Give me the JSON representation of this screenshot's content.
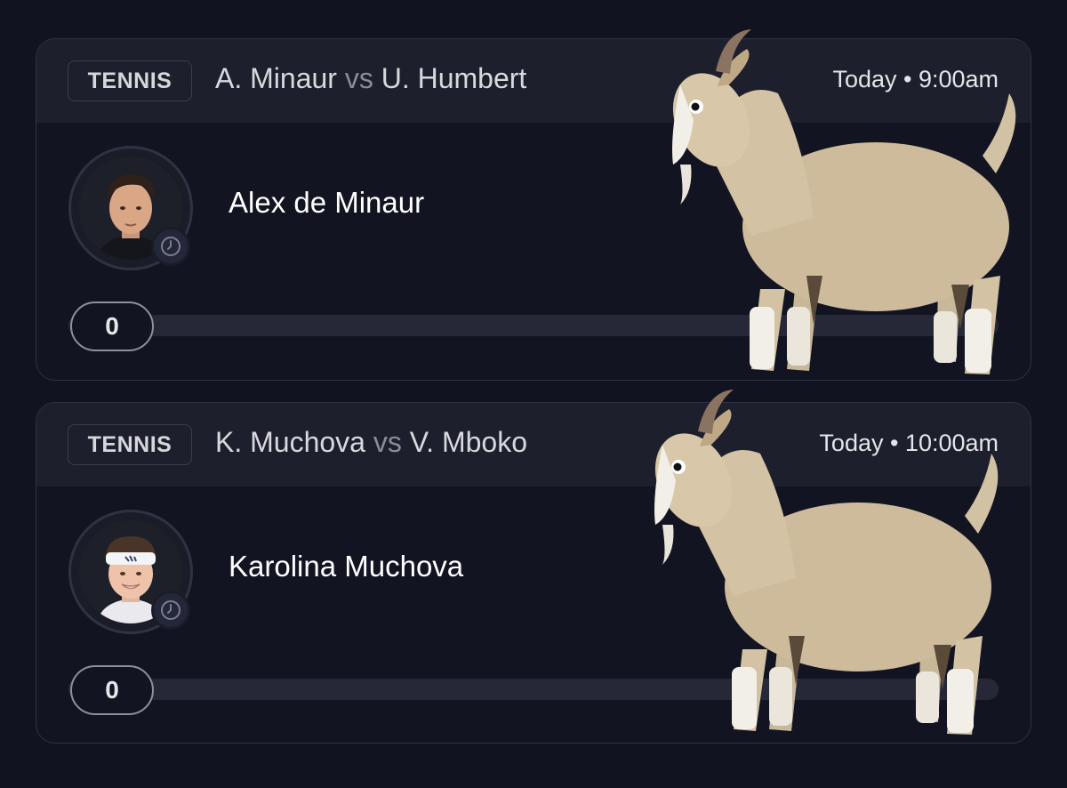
{
  "matches": [
    {
      "sport_label": "TENNIS",
      "player1": "A. Minaur",
      "vs": "vs",
      "player2": "U. Humbert",
      "time": "Today • 9:00am",
      "player_name": "Alex de Minaur",
      "score": "0",
      "slider_fraction": 0
    },
    {
      "sport_label": "TENNIS",
      "player1": "K. Muchova",
      "vs": "vs",
      "player2": "V. Mboko",
      "time": "Today • 10:00am",
      "player_name": "Karolina Muchova",
      "score": "0",
      "slider_fraction": 0
    }
  ],
  "icons": {
    "avatar_status": "clock-icon",
    "overlay": "goat-emoji"
  }
}
